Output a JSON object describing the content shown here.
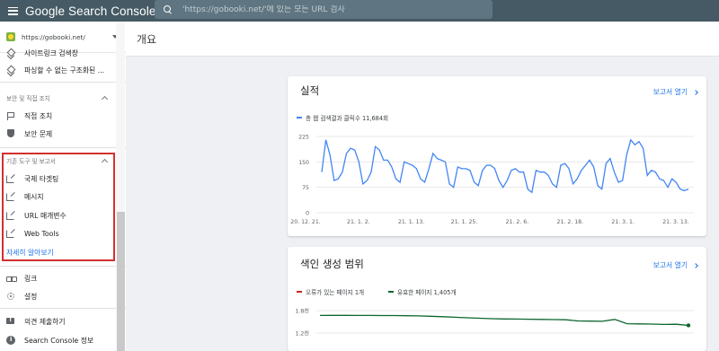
{
  "header": {
    "app_title": "Google Search Console",
    "search_placeholder": "'https://gobooki.net/'에 있는 모든 URL 검사"
  },
  "sidebar": {
    "property": "https://gobooki.net/",
    "items_top": [
      {
        "label": "사이트링크 검색창",
        "icon": "layers-icon"
      },
      {
        "label": "파싱할 수 없는 구조화된 ...",
        "icon": "layers-icon"
      }
    ],
    "security_section": {
      "header": "보안 및 직접 조치",
      "items": [
        {
          "label": "직접 조치",
          "icon": "flag-icon"
        },
        {
          "label": "보안 문제",
          "icon": "shield-icon"
        }
      ]
    },
    "legacy_section": {
      "header": "기존 도구 및 보고서",
      "items": [
        {
          "label": "국제 타겟팅",
          "icon": "external-link-icon"
        },
        {
          "label": "메시지",
          "icon": "external-link-icon"
        },
        {
          "label": "URL 매개변수",
          "icon": "external-link-icon"
        },
        {
          "label": "Web Tools",
          "icon": "external-link-icon"
        }
      ],
      "learn_more": "자세히 알아보기"
    },
    "items_bottom": [
      {
        "label": "링크",
        "icon": "link-icon"
      },
      {
        "label": "설정",
        "icon": "gear-icon"
      },
      {
        "label": "의견 제출하기",
        "icon": "feedback-icon"
      },
      {
        "label": "Search Console 정보",
        "icon": "info-icon"
      }
    ]
  },
  "main": {
    "page_title": "개요",
    "performance": {
      "title": "실적",
      "report_link": "보고서 열기",
      "legend": "총 웹 검색결과 클릭수 11,684회",
      "y_ticks": [
        "225",
        "150",
        "75",
        "0"
      ],
      "x_ticks": [
        "20. 12. 21.",
        "21. 1. 2.",
        "21. 1. 13.",
        "21. 1. 25.",
        "21. 2. 6.",
        "21. 2. 18.",
        "21. 3. 1.",
        "21. 3. 13."
      ]
    },
    "coverage": {
      "title": "색인 생성 범위",
      "report_link": "보고서 열기",
      "legend_error": "오류가 있는 페이지 1개",
      "legend_valid": "유효한 페이지 1,405개",
      "y_ticks": [
        "1.8천",
        "1.2천"
      ]
    }
  },
  "colors": {
    "topbar": "#455a64",
    "clicks_line": "#4285f4",
    "valid_line": "#0d652d",
    "error_line": "#c5221f",
    "highlight": "#d32f2f"
  },
  "chart_data": [
    {
      "type": "line",
      "title": "",
      "series": [
        {
          "name": "총 웹 검색결과 클릭수 11,684회",
          "values": [
            120,
            215,
            170,
            95,
            100,
            120,
            175,
            190,
            185,
            150,
            85,
            95,
            120,
            195,
            185,
            155,
            155,
            135,
            100,
            90,
            150,
            145,
            140,
            130,
            100,
            90,
            130,
            175,
            160,
            155,
            150,
            85,
            75,
            135,
            130,
            130,
            125,
            90,
            80,
            125,
            140,
            140,
            130,
            95,
            75,
            95,
            125,
            130,
            120,
            120,
            70,
            60,
            125,
            120,
            120,
            110,
            85,
            75,
            140,
            145,
            130,
            85,
            100,
            125,
            140,
            155,
            135,
            80,
            70,
            145,
            160,
            120,
            90,
            95,
            170,
            215,
            200,
            210,
            190,
            110,
            125,
            120,
            100,
            95,
            75,
            100,
            90,
            70,
            65,
            70
          ]
        }
      ],
      "x_tick_labels": [
        "20. 12. 21.",
        "21. 1. 2.",
        "21. 1. 13.",
        "21. 1. 25.",
        "21. 2. 6.",
        "21. 2. 18.",
        "21. 3. 1.",
        "21. 3. 13."
      ],
      "ylim": [
        0,
        225
      ],
      "y_ticks": [
        0,
        75,
        150,
        225
      ],
      "grid": true
    },
    {
      "type": "line",
      "title": "",
      "series": [
        {
          "name": "유효한 페이지 1,405개",
          "values": [
            1670,
            1672,
            1672,
            1671,
            1670,
            1669,
            1667,
            1664,
            1658,
            1648,
            1636,
            1622,
            1608,
            1596,
            1585,
            1578,
            1574,
            1570,
            1565,
            1560,
            1555,
            1525,
            1520,
            1515,
            1565,
            1450,
            1445,
            1440,
            1430,
            1435,
            1405
          ]
        },
        {
          "name": "오류가 있는 페이지 1개",
          "values": [
            1
          ]
        }
      ],
      "ylim": [
        1200,
        1800
      ],
      "y_ticks": [
        1200,
        1800
      ],
      "grid": true
    }
  ]
}
